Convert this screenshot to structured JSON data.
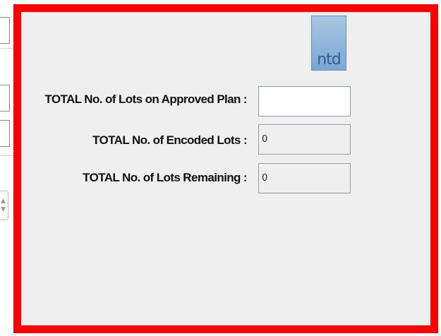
{
  "form": {
    "approved_plan": {
      "label": "TOTAL No. of Lots on Approved Plan :",
      "value": ""
    },
    "encoded": {
      "label": "TOTAL No. of Encoded Lots :",
      "value": "0"
    },
    "remaining": {
      "label": "TOTAL No. of Lots Remaining :",
      "value": "0"
    }
  },
  "logo": {
    "text": "ntd",
    "icon": "ntd-logo-icon"
  },
  "colors": {
    "highlight_border": "#ff0000",
    "panel_background": "#efefef",
    "logo_blue": "#7aa7d2"
  }
}
